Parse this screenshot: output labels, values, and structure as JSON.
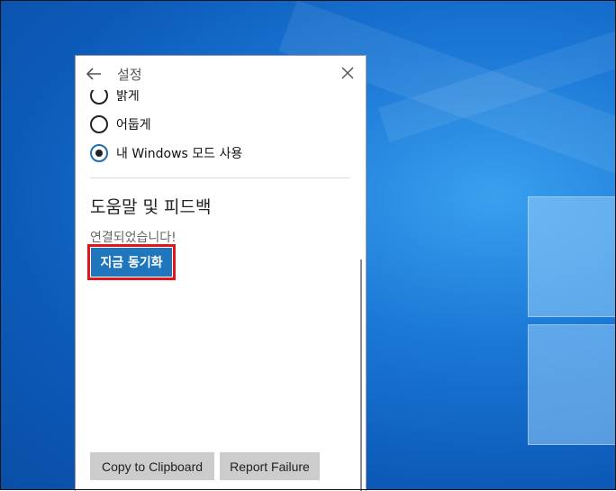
{
  "window": {
    "title": "설정"
  },
  "theme_options": [
    {
      "label": "밝게",
      "checked": false
    },
    {
      "label": "어둡게",
      "checked": false
    },
    {
      "label": "내 Windows 모드 사용",
      "checked": true
    }
  ],
  "help_section": {
    "heading": "도움말 및 피드백",
    "status": "연결되었습니다!",
    "sync_button_label": "지금 동기화"
  },
  "footer": {
    "copy_label": "Copy to Clipboard",
    "report_label": "Report Failure"
  },
  "colors": {
    "accent": "#1f76bd",
    "highlight": "#e3151a"
  }
}
